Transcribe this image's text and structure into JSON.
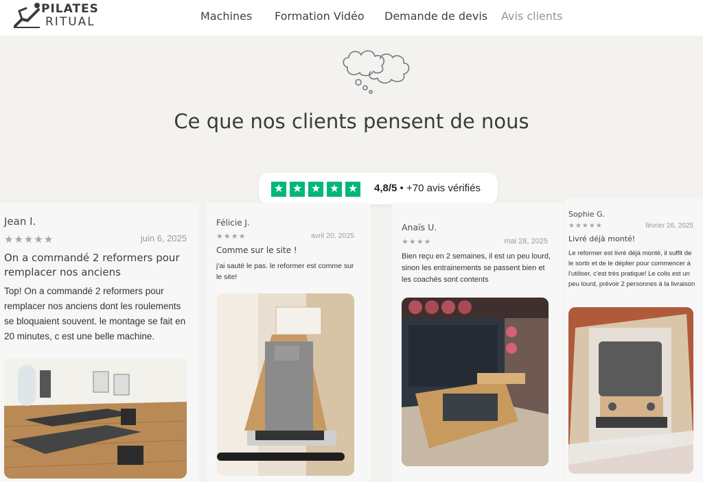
{
  "brand": {
    "line1": "PILATES",
    "line2": "RITUAL"
  },
  "nav": {
    "items": [
      {
        "label": "Machines"
      },
      {
        "label": "Formation Vidéo"
      },
      {
        "label": "Demande de devis"
      },
      {
        "label": "Avis clients"
      }
    ],
    "active_index": 3
  },
  "hero": {
    "title": "Ce que nos clients pensent de nous",
    "icon": "thought-cloud-icon"
  },
  "rating": {
    "score": "4,8/5",
    "separator": "•",
    "count": "+70 avis vérifiés",
    "stars": 5,
    "star_color": "#00b67a"
  },
  "reviews": [
    {
      "name": "Jean I.",
      "stars": "★★★★★",
      "date": "juin 6, 2025",
      "title": "On a commandé 2 reformers pour remplacer nos anciens",
      "body": "Top! On a commandé 2 reformers pour remplacer nos anciens dont les roulements se bloquaient souvent. le montage se fait en 20 minutes, c est une belle machine.",
      "photo": "studio-reformers-photo"
    },
    {
      "name": "Félicie J.",
      "stars": "★★★★",
      "date": "avril 20, 2025",
      "title": "Comme sur le site !",
      "body": "j'ai sauté le pas. le reformer est comme sur le site!",
      "photo": "unboxed-reformer-photo"
    },
    {
      "name": "Anaïs U.",
      "stars": "★★★★",
      "date": "mai 28, 2025",
      "title": "",
      "body": "Bien reçu en 2 semaines, il est un peu lourd, sinon les entrainements se passent bien et les coachés sont contents",
      "photo": "gym-reformer-photo"
    },
    {
      "name": "Sophie G.",
      "stars": "★★★★★",
      "date": "février 26, 2025",
      "title": "Livré déjà monté!",
      "body": "Le reformer est livré déjà monté, il suffit de le sortir et de le déplier pour commencer à l'utiliser, c'est très pratique! Le colis est un peu lourd, prévoir 2 personnes à la livraison",
      "photo": "packaged-reformer-photo"
    }
  ]
}
